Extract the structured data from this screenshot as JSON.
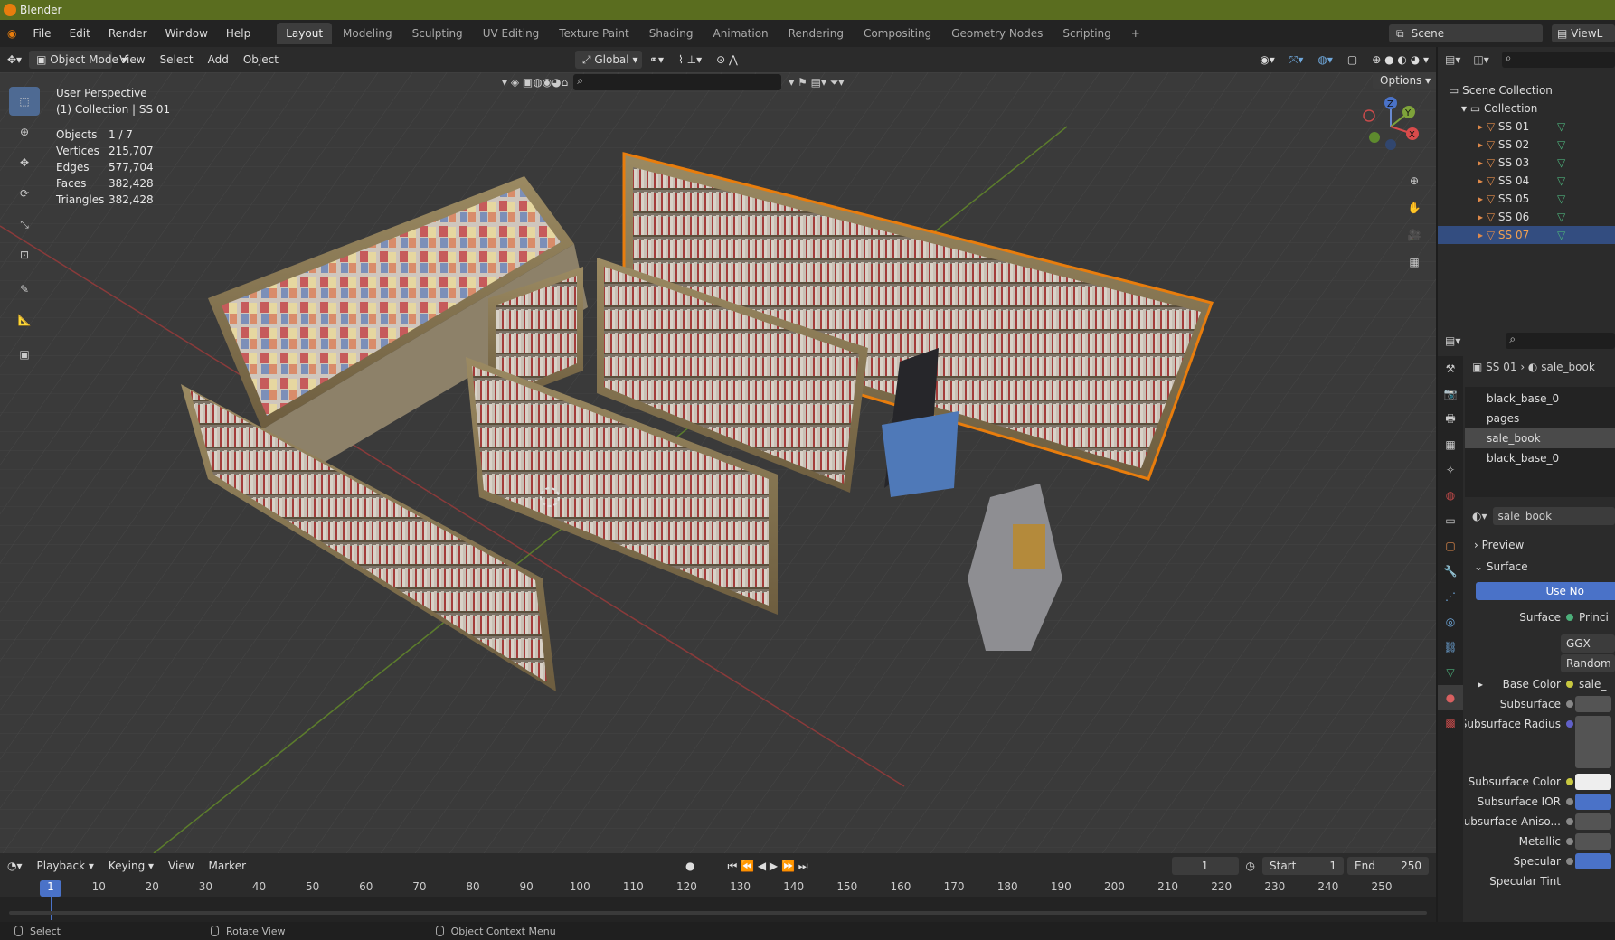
{
  "window": {
    "title": "Blender"
  },
  "menus": [
    "File",
    "Edit",
    "Render",
    "Window",
    "Help"
  ],
  "workspaces": [
    {
      "label": "Layout",
      "active": true
    },
    {
      "label": "Modeling"
    },
    {
      "label": "Sculpting"
    },
    {
      "label": "UV Editing"
    },
    {
      "label": "Texture Paint"
    },
    {
      "label": "Shading"
    },
    {
      "label": "Animation"
    },
    {
      "label": "Rendering"
    },
    {
      "label": "Compositing"
    },
    {
      "label": "Geometry Nodes"
    },
    {
      "label": "Scripting"
    }
  ],
  "add_workspace": "+",
  "scene": {
    "name": "Scene",
    "view_layer": "ViewL"
  },
  "viewport_header": {
    "mode": "Object Mode",
    "view": "View",
    "select": "Select",
    "add": "Add",
    "object": "Object",
    "transform": "Global",
    "options": "Options"
  },
  "overlay_text": {
    "perspective": "User Perspective",
    "collection": "(1) Collection | SS 01"
  },
  "stats": [
    {
      "label": "Objects",
      "value": "1 / 7"
    },
    {
      "label": "Vertices",
      "value": "215,707"
    },
    {
      "label": "Edges",
      "value": "577,704"
    },
    {
      "label": "Faces",
      "value": "382,428"
    },
    {
      "label": "Triangles",
      "value": "382,428"
    }
  ],
  "gizmo": {
    "x": "X",
    "y": "Y",
    "z": "Z"
  },
  "outliner": {
    "root": "Scene Collection",
    "collection": "Collection",
    "items": [
      {
        "name": "SS 01"
      },
      {
        "name": "SS 02"
      },
      {
        "name": "SS 03"
      },
      {
        "name": "SS 04"
      },
      {
        "name": "SS 05"
      },
      {
        "name": "SS 06"
      },
      {
        "name": "SS 07",
        "selected": true
      }
    ]
  },
  "properties": {
    "breadcrumb_object": "SS 01",
    "breadcrumb_material": "sale_book",
    "slots": [
      {
        "name": "black_base_0"
      },
      {
        "name": "pages"
      },
      {
        "name": "sale_book",
        "selected": true
      },
      {
        "name": "black_base_0"
      }
    ],
    "material_name": "sale_book",
    "preview": "Preview",
    "surface_section": "Surface",
    "use_nodes": "Use No",
    "rows": [
      {
        "label": "Surface",
        "value": "Princi"
      },
      {
        "label": "",
        "value": "GGX"
      },
      {
        "label": "",
        "value": "Random"
      },
      {
        "label": "Base Color",
        "value": "sale_"
      },
      {
        "label": "Subsurface",
        "value": ""
      },
      {
        "label": "Subsurface Radius",
        "value": ""
      },
      {
        "label": "Subsurface Color",
        "value": ""
      },
      {
        "label": "Subsurface IOR",
        "value": ""
      },
      {
        "label": "Subsurface Aniso...",
        "value": ""
      },
      {
        "label": "Metallic",
        "value": ""
      },
      {
        "label": "Specular",
        "value": ""
      },
      {
        "label": "Specular Tint",
        "value": ""
      }
    ]
  },
  "timeline": {
    "playback": "Playback",
    "keying": "Keying",
    "view": "View",
    "marker": "Marker",
    "current_frame": "1",
    "start_label": "Start",
    "start": "1",
    "end_label": "End",
    "end": "250",
    "ruler": [
      "1",
      "10",
      "20",
      "30",
      "40",
      "50",
      "60",
      "70",
      "80",
      "90",
      "100",
      "110",
      "120",
      "130",
      "140",
      "150",
      "160",
      "170",
      "180",
      "190",
      "200",
      "210",
      "220",
      "230",
      "240",
      "250"
    ]
  },
  "statusbar": {
    "select": "Select",
    "rotate": "Rotate View",
    "context": "Object Context Menu"
  },
  "colors": {
    "accent": "#4e6a93",
    "selection": "#e87d0d",
    "title_bar": "#5a6d1f"
  }
}
